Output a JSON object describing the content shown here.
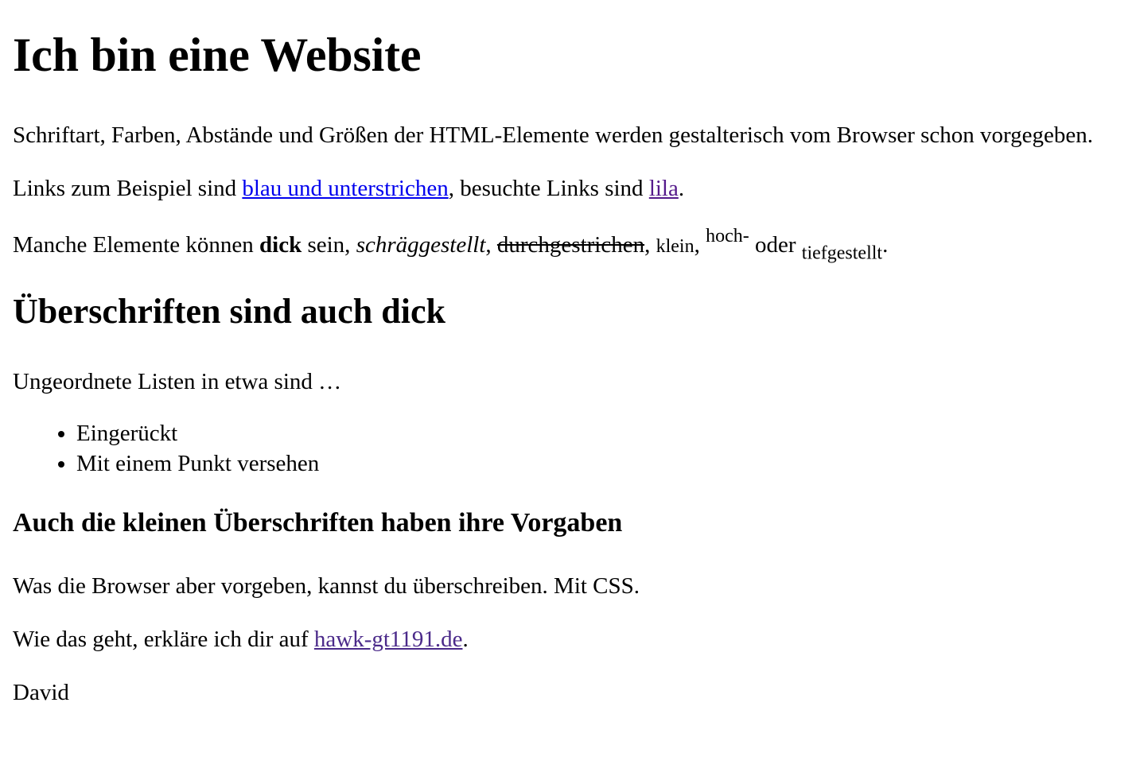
{
  "heading_main": "Ich bin eine Website",
  "intro": "Schriftart, Farben, Abstände und Größen der HTML-Elemente werden gestalterisch vom Browser schon vorgegeben.",
  "links_paragraph": {
    "before": "Links zum Beispiel sind ",
    "link_text": "blau und unterstrichen",
    "middle": ", besuchte Links sind ",
    "visited_link_text": "lila",
    "after": "."
  },
  "elements_paragraph": {
    "before": "Manche Elemente können ",
    "bold": "dick",
    "after_bold": " sein, ",
    "italic": "schräggestellt",
    "after_italic": ", ",
    "strikethrough": "durchgestrichen",
    "after_strike": ", ",
    "small": "klein",
    "after_small": ", ",
    "superscript": "hoch-",
    "after_sup": " oder ",
    "subscript": "tiefgestellt",
    "end": "."
  },
  "heading_sub": "Überschriften sind auch dick",
  "lists_intro": "Ungeordnete Listen in etwa sind …",
  "list_items": [
    "Eingerückt",
    "Mit einem Punkt versehen"
  ],
  "heading_small": "Auch die kleinen Überschriften haben ihre Vorgaben",
  "css_paragraph": "Was die Browser aber vorgeben, kannst du überschreiben. Mit CSS.",
  "howto_paragraph": {
    "before": "Wie das geht, erkläre ich dir auf ",
    "link_text": "hawk-gt1191.de",
    "after": "."
  },
  "author": "David",
  "colors": {
    "link": "#0000ee",
    "visited_link": "#551a8b",
    "text": "#000000",
    "background": "#ffffff"
  }
}
